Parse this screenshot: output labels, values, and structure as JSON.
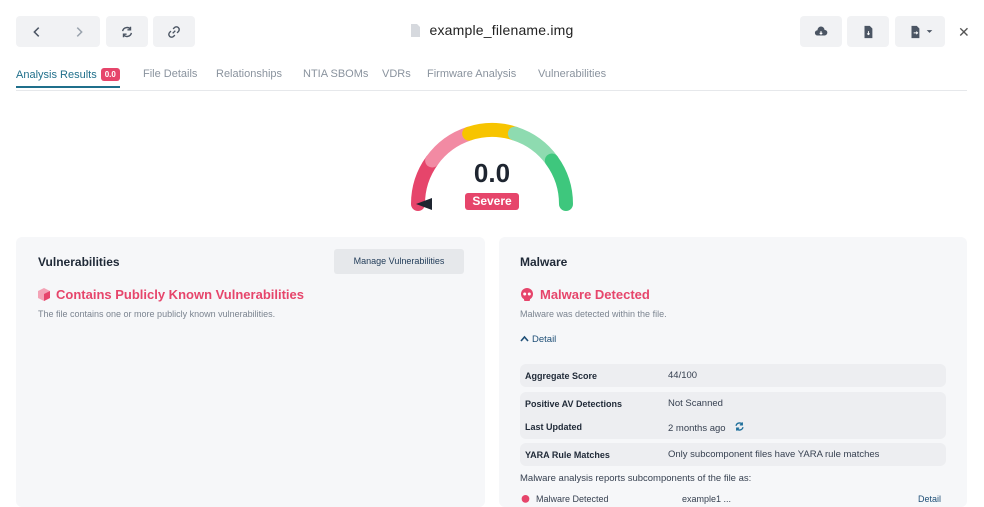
{
  "header": {
    "title": "example_filename.img"
  },
  "tabs": [
    {
      "label": "Analysis Results",
      "badge": "0.0"
    },
    {
      "label": "File Details"
    },
    {
      "label": "Relationships"
    },
    {
      "label": "NTIA SBOMs"
    },
    {
      "label": "VDRs"
    },
    {
      "label": "Firmware Analysis"
    },
    {
      "label": "Vulnerabilities"
    }
  ],
  "gauge": {
    "value": "0.0",
    "label": "Severe",
    "colors": [
      "#e6456b",
      "#f28aa3",
      "#f7c400",
      "#8edbb0",
      "#3ec77d"
    ]
  },
  "vulnerabilities_card": {
    "title": "Vulnerabilities",
    "manage_label": "Manage Vulnerabilities",
    "alert_title": "Contains Publicly Known Vulnerabilities",
    "alert_desc": "The file contains one or more publicly known vulnerabilities."
  },
  "malware_card": {
    "title": "Malware",
    "alert_title": "Malware Detected",
    "alert_desc": "Malware was detected within the file.",
    "detail_label": "Detail",
    "rows": [
      {
        "label": "Aggregate Score",
        "value": "44/100"
      },
      {
        "label": "Positive AV Detections",
        "value": "Not Scanned"
      },
      {
        "label": "Last Updated",
        "value": "2 months ago"
      },
      {
        "label": "YARA Rule Matches",
        "value": "Only subcomponent files have YARA rule matches"
      }
    ],
    "subcomponents_note": "Malware analysis reports subcomponents of the file as:",
    "sub_row": {
      "label": "Malware Detected",
      "file": "example1 ...",
      "detail": "Detail"
    }
  }
}
